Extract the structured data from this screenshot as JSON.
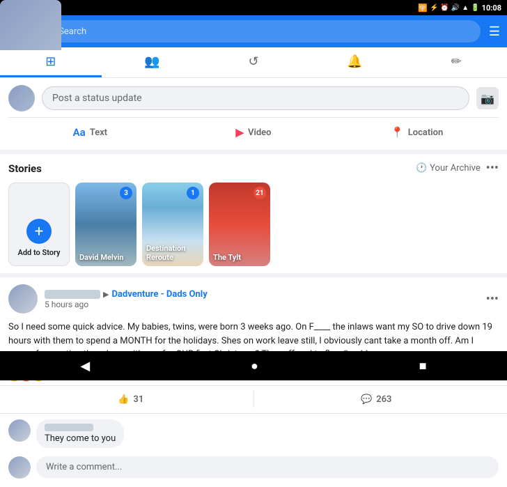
{
  "statusBar": {
    "time": "10:08",
    "icons": [
      "twitter",
      "facebook",
      "gmail",
      "youtube",
      "facebook",
      "monitor",
      "wifi",
      "bluetooth",
      "alarm",
      "volume",
      "signal",
      "battery"
    ]
  },
  "navBar": {
    "searchPlaceholder": "Search",
    "menuIcon": "☰"
  },
  "tabs": [
    {
      "label": "⊞",
      "id": "home",
      "active": true
    },
    {
      "label": "👥",
      "id": "friends",
      "active": false
    },
    {
      "label": "↺",
      "id": "watch",
      "active": false
    },
    {
      "label": "🔔",
      "id": "notifications",
      "active": false
    },
    {
      "label": "✏",
      "id": "create",
      "active": false
    }
  ],
  "postBox": {
    "placeholder": "Post a status update",
    "textBtn": "Text",
    "videoBtn": "Video",
    "locationBtn": "Location"
  },
  "stories": {
    "title": "Stories",
    "archiveLabel": "Your Archive",
    "addLabel": "Add to Story",
    "items": [
      {
        "name": "David Melvin",
        "badge": "3",
        "bgClass": "story-bg-1"
      },
      {
        "name": "Destination Reroute",
        "badge": "1",
        "bgClass": "story-bg-2"
      },
      {
        "name": "The Tylt",
        "badge": "21",
        "bgClass": "story-bg-3",
        "badgeClass": "story-badge-red"
      }
    ]
  },
  "post": {
    "userName": "Blurred User",
    "groupArrow": "▶",
    "groupName": "Dadventure - Dads Only",
    "timeAgo": "5 hours ago",
    "text": "So I need some quick advice. My babies, twins, were born 3 weeks ago. On F____ the inlaws want my SO to drive down 19 hours with them to spend a MONTH for the holidays. Shes on work leave still, I obviously cant take a month off. Am I wrong for wanting them here with me, for OUR first Christmas? They offered to fly...",
    "seeMore": "See More",
    "reactionEmojis": "😮😡😢",
    "reactionCount": "31",
    "likeCount": "31",
    "commentCount": "263",
    "likeLabel": "31",
    "commentLabel": "263"
  },
  "comment": {
    "authorName": "Blurred Commenter",
    "text": "They come to you",
    "inputPlaceholder": "Write a comment..."
  },
  "bottomNav": {
    "backBtn": "◀",
    "homeBtn": "●",
    "squareBtn": "■"
  }
}
